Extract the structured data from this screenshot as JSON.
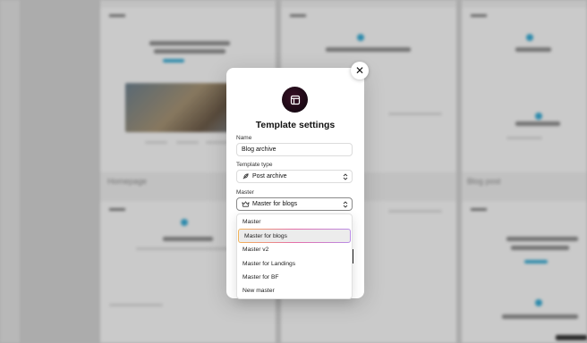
{
  "modal": {
    "title": "Template settings",
    "close_label": "✕",
    "name_label": "Name",
    "name_value": "Blog archive",
    "type_label": "Template type",
    "type_value": "Post archive",
    "master_label": "Master",
    "master_value": "Master for blogs"
  },
  "dropdown": {
    "options": [
      "Master",
      "Master for blogs",
      "Master v2",
      "Master for Landings",
      "Master for BF",
      "New master"
    ],
    "selected_index": 1
  },
  "background": {
    "card_labels": [
      "Homepage",
      "Blog post"
    ]
  },
  "colors": {
    "accent": "#39a8cf",
    "icon_bg": "#2a0c1d",
    "selection_gradient": [
      "#f3b457",
      "#e56fa9",
      "#b98de6"
    ]
  }
}
